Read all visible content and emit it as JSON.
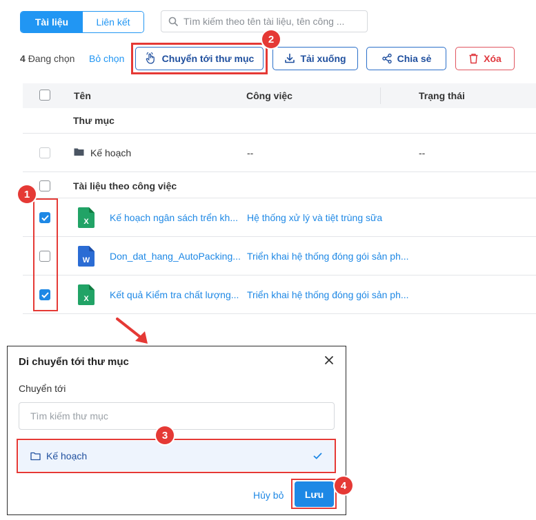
{
  "tabs": {
    "documents": "Tài liệu",
    "links": "Liên kết"
  },
  "search": {
    "placeholder": "Tìm kiếm theo tên tài liệu, tên công ..."
  },
  "action_bar": {
    "count": "4",
    "count_suffix": "Đang chọn",
    "deselect": "Bỏ chọn",
    "move": "Chuyển tới thư mục",
    "download": "Tải xuống",
    "share": "Chia sẻ",
    "delete": "Xóa"
  },
  "table": {
    "headers": {
      "name": "Tên",
      "task": "Công việc",
      "status": "Trạng thái"
    },
    "folder_group": "Thư mục",
    "folder_row": {
      "name": "Kế hoạch",
      "task": "--",
      "status": "--"
    },
    "doc_group": "Tài liệu theo công việc",
    "docs": [
      {
        "name": "Kế hoạch ngân sách trển kh...",
        "task": "Hệ thống xử lý và tiệt trùng sữa",
        "type": "X",
        "checked": true
      },
      {
        "name": "Don_dat_hang_AutoPacking...",
        "task": "Triển khai hệ thống đóng gói sản ph...",
        "type": "W",
        "checked": false
      },
      {
        "name": "Kết quả Kiểm tra chất lượng...",
        "task": "Triển khai hệ thống đóng gói sản ph...",
        "type": "X",
        "checked": true
      }
    ]
  },
  "modal": {
    "title": "Di chuyển tới thư mục",
    "label": "Chuyển tới",
    "search_placeholder": "Tìm kiếm thư mục",
    "folder_option": "Kế hoạch",
    "cancel": "Hủy bỏ",
    "save": "Lưu"
  },
  "steps": [
    "1",
    "2",
    "3",
    "4"
  ],
  "colors": {
    "accent": "#1e88e5",
    "highlight": "#e53935",
    "excel": "#21a366",
    "word": "#2b6cd4"
  }
}
